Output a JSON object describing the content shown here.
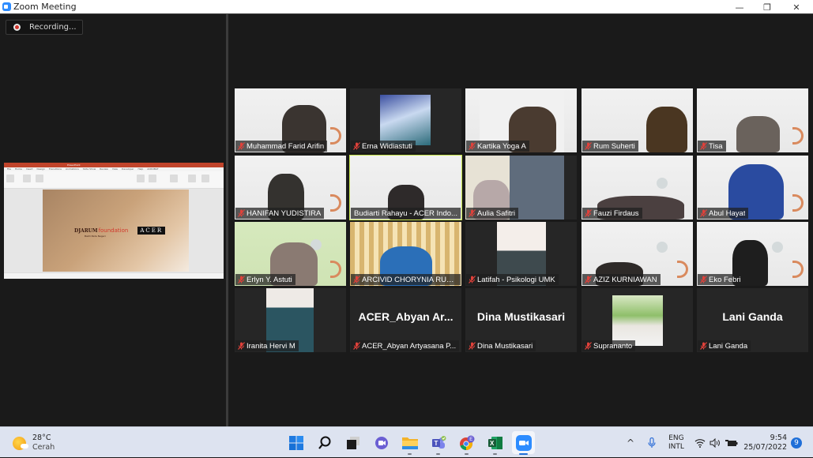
{
  "window": {
    "title": "Zoom Meeting",
    "controls": {
      "minimize": "—",
      "maximize": "❐",
      "close": "✕"
    }
  },
  "recording": {
    "label": "Recording..."
  },
  "shared_screen": {
    "app": "PowerPoint",
    "ribbon_tabs": [
      "File",
      "Home",
      "Insert",
      "Design",
      "Transitions",
      "Animations",
      "Slide Show",
      "Review",
      "View",
      "Developer",
      "Help",
      "ACROBAT"
    ],
    "slide": {
      "brand_primary": "DJARUM",
      "brand_secondary": "foundation",
      "brand_tagline": "Bakti Pada Negeri",
      "partner_logo": "ACER"
    }
  },
  "participants": [
    {
      "name": "Muhammad Farid Arifin",
      "muted": true,
      "video": "camera",
      "bg": "vbg"
    },
    {
      "name": "Erna Widiastuti",
      "muted": true,
      "video": "picture",
      "bg": "vdark"
    },
    {
      "name": "Kartika Yoga A",
      "muted": true,
      "video": "camera",
      "bg": "vbg"
    },
    {
      "name": "Rum Suherti",
      "muted": true,
      "video": "camera",
      "bg": "vbg"
    },
    {
      "name": "Tisa",
      "muted": true,
      "video": "camera",
      "bg": "vbg"
    },
    {
      "name": "HANIFAN YUDISTIRA",
      "muted": true,
      "video": "camera",
      "bg": "vbg"
    },
    {
      "name": "Budiarti Rahayu - ACER Indo...",
      "muted": false,
      "video": "camera",
      "bg": "vbg",
      "active_speaker": true
    },
    {
      "name": "Aulia Safitri",
      "muted": true,
      "video": "camera",
      "bg": "vdark"
    },
    {
      "name": "Fauzi Firdaus",
      "muted": true,
      "video": "camera",
      "bg": "vbg"
    },
    {
      "name": "Abul Hayat",
      "muted": true,
      "video": "camera",
      "bg": "vbg"
    },
    {
      "name": "Erlyn Y. Astuti",
      "muted": true,
      "video": "camera",
      "bg": "vgreen"
    },
    {
      "name": "ARCIVID CHORYNIA RUB...",
      "muted": true,
      "video": "camera",
      "bg": "vcurtain"
    },
    {
      "name": "Latifah - Psikologi UMK",
      "muted": true,
      "video": "camera",
      "bg": "vdark"
    },
    {
      "name": "AZIZ KURNIAWAN",
      "muted": true,
      "video": "camera",
      "bg": "vbg"
    },
    {
      "name": "Eko Febri",
      "muted": true,
      "video": "camera",
      "bg": "vbg"
    },
    {
      "name": "Iranita Hervi M",
      "muted": true,
      "video": "picture",
      "bg": "vdark"
    },
    {
      "name": "ACER_Abyan Artyasana P...",
      "display_name": "ACER_Abyan  Ar...",
      "muted": true,
      "video": "off",
      "bg": "vdark"
    },
    {
      "name": "Dina Mustikasari",
      "display_name": "Dina Mustikasari",
      "muted": true,
      "video": "off",
      "bg": "vdark"
    },
    {
      "name": "Suprananto",
      "muted": true,
      "video": "picture",
      "bg": "vdark"
    },
    {
      "name": "Lani Ganda",
      "display_name": "Lani Ganda",
      "muted": true,
      "video": "off",
      "bg": "vdark"
    }
  ],
  "colors": {
    "active_speaker_border": "#c5e34a",
    "mic_off": "#e0413a",
    "zoom_blue": "#2d8cff",
    "meeting_bg": "#1a1a1a"
  },
  "taskbar": {
    "weather": {
      "temp": "28°C",
      "condition": "Cerah"
    },
    "apps": [
      {
        "name": "start",
        "icon": "windows-icon"
      },
      {
        "name": "search",
        "icon": "search-icon"
      },
      {
        "name": "task-view",
        "icon": "task-view-icon"
      },
      {
        "name": "chat",
        "icon": "teams-chat-icon"
      },
      {
        "name": "file-explorer",
        "icon": "folder-icon",
        "running": true
      },
      {
        "name": "teams",
        "icon": "teams-icon",
        "running": true
      },
      {
        "name": "chrome",
        "icon": "chrome-icon",
        "running": true,
        "badge": "E"
      },
      {
        "name": "excel",
        "icon": "excel-icon",
        "running": true
      },
      {
        "name": "zoom",
        "icon": "zoom-icon",
        "running": true,
        "active": true
      }
    ],
    "tray": {
      "chevron": "^",
      "lang_line1": "ENG",
      "lang_line2": "INTL",
      "time": "9:54",
      "date": "25/07/2022",
      "notifications": "9"
    }
  }
}
